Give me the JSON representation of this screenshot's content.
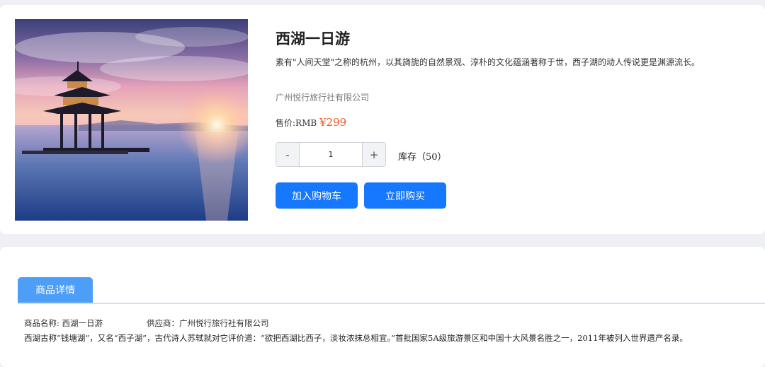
{
  "product": {
    "title": "西湖一日游",
    "description": "素有\"人间天堂\"之称的杭州，以其旖旎的自然景观、淳朴的文化蕴涵著称于世，西子湖的动人传说更是渊源流长。",
    "supplier": "广州悦行旅行社有限公司",
    "price_label": "售价:RMB",
    "price": "¥299",
    "quantity": "1",
    "minus_label": "-",
    "plus_label": "+",
    "stock": "库存（50）",
    "add_to_cart_label": "加入购物车",
    "buy_now_label": "立即购买",
    "image_icon": "west-lake-pavilion-sunset-photo"
  },
  "detail": {
    "tab_label": "商品详情",
    "name_field": "商品名称: 西湖一日游",
    "supplier_field": "供应商：广州悦行旅行社有限公司",
    "text": "西湖古称“钱塘湖”，又名“西子湖”，古代诗人苏轼就对它评价道：“欲把西湖比西子，淡妆浓抹总相宜。”首批国家5A级旅游景区和中国十大风景名胜之一，2011年被列入世界遗产名录。"
  },
  "colors": {
    "primary": "#1677ff",
    "tab": "#4d9ef7",
    "price": "#f05a28",
    "background": "#eef0f4"
  }
}
